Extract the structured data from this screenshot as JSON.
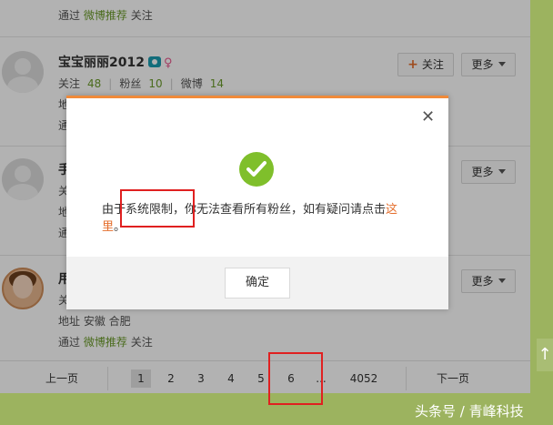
{
  "rows": [
    {
      "via_prefix": "通过",
      "via_link": "微博推荐",
      "via_suffix": "关注"
    },
    {
      "name": "宝宝丽丽2012",
      "stats": {
        "follow_label": "关注",
        "follow": "48",
        "fans_label": "粉丝",
        "fans": "10",
        "weibo_label": "微博",
        "weibo": "14"
      },
      "address_label": "地",
      "via_prefix": "通",
      "follow_button": "关注",
      "more_button": "更多"
    },
    {
      "name": "手",
      "line1": "关",
      "line2": "地",
      "line3": "通",
      "more_button": "更多"
    },
    {
      "name": "用",
      "line1": "关",
      "address": "地址 安徽 合肥",
      "via_prefix": "通过",
      "via_link": "微博推荐",
      "via_suffix": "关注",
      "more_button": "更多"
    }
  ],
  "pager": {
    "prev": "上一页",
    "pages": [
      "1",
      "2",
      "3",
      "4",
      "5",
      "6"
    ],
    "ellipsis": "...",
    "last": "4052",
    "next": "下一页",
    "current": "1"
  },
  "dialog": {
    "message": "由于系统限制，你无法查看所有粉丝，如有疑问请点击",
    "link": "这里",
    "link_suffix": "。",
    "confirm": "确定"
  },
  "scroll_top_icon": "↑",
  "watermark": "头条号 / 青峰科技",
  "colors": {
    "accent": "#6c9b2b",
    "link": "#e46d2b",
    "success": "#7fbf2b",
    "highlight": "#e02020",
    "frame": "#9cb35f"
  }
}
